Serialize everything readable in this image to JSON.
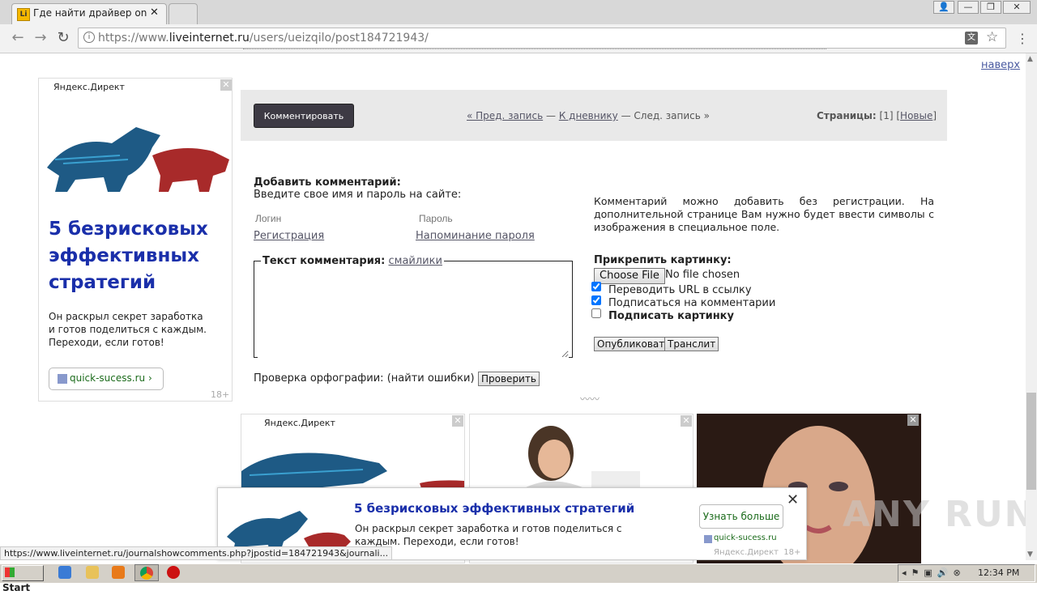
{
  "browser": {
    "tab_title": "Где найти драйвер onext",
    "url_prefix": "https://www.",
    "url_domain": "liveinternet.ru",
    "url_path": "/users/ueizqilo/post184721943/"
  },
  "page": {
    "top_link": "наверх",
    "comment_button": "Комментировать",
    "nav_prev": "« Пред. запись",
    "nav_sep1": "—",
    "nav_diary": "К дневнику",
    "nav_sep2": "—",
    "nav_next": "След. запись »",
    "pages_label": "Страницы:",
    "pages_current": "[1]",
    "pages_new_open": "[",
    "pages_new": "Новые",
    "pages_new_close": "]"
  },
  "comment_form": {
    "heading": "Добавить комментарий:",
    "subheading": "Введите свое имя и пароль на сайте:",
    "login_placeholder": "Логин",
    "password_placeholder": "Пароль",
    "register_link": "Регистрация",
    "remind_link": "Напоминание пароля",
    "text_legend": "Текст комментария:",
    "smiles_link": "смайлики",
    "spell_label": "Проверка орфографии:",
    "spell_find": "(найти ошибки)",
    "spell_button": "Проверить",
    "note": "Комментарий можно добавить без регистрации. На дополнительной странице Вам нужно будет ввести символы с изображения в специальное поле.",
    "attach_label": "Прикрепить картинку:",
    "choose_file": "Choose File",
    "no_file": "No file chosen",
    "opt_url": "Переводить URL в ссылку",
    "opt_subscribe": "Подписаться на комментарии",
    "opt_sign": "Подписать картинку",
    "opt_url_checked": true,
    "opt_subscribe_checked": true,
    "opt_sign_checked": false,
    "publish_button": "Опубликовать",
    "translit_button": "Транслит"
  },
  "side_ad": {
    "brand": "Яндекс.Директ",
    "headline": "5 безрисковых эффективных стратегий",
    "body": "Он раскрыл секрет заработка и готов поделиться с каждым. Переходи, если готов!",
    "link": "quick-sucess.ru ›",
    "age": "18+"
  },
  "bottom_ads": {
    "brand": "Яндекс.Директ"
  },
  "popup_ad": {
    "headline": "5 безрисковых эффективных стратегий",
    "body": "Он раскрыл секрет заработка и готов поделиться с каждым. Переходи, если готов!",
    "button": "Узнать больше",
    "domain": "quick-sucess.ru",
    "footer": "Яндекс.Директ  18+"
  },
  "status_bar": {
    "text": "https://www.liveinternet.ru/journalshowcomments.php?jpostid=184721943&journali..."
  },
  "taskbar": {
    "start": "Start",
    "clock": "12:34 PM"
  },
  "watermark": "ANY RUN"
}
